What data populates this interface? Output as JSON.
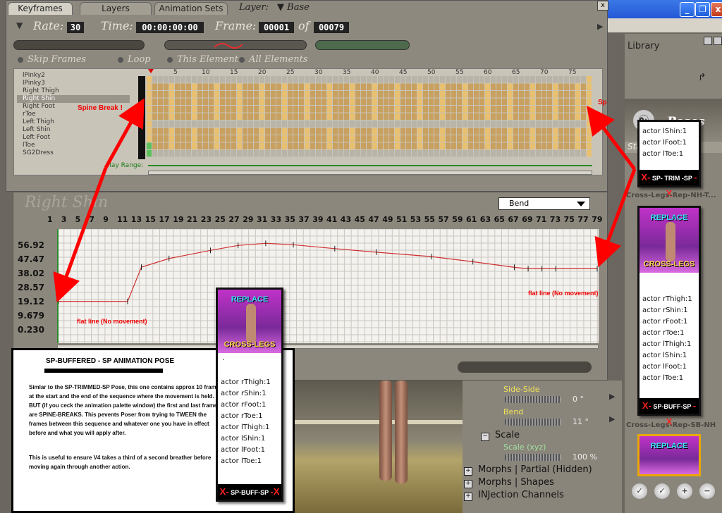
{
  "window": {
    "close": "x",
    "restore": "❐",
    "minimize": "_"
  },
  "tabs": [
    "Keyframes",
    "Layers",
    "Animation Sets"
  ],
  "layer": {
    "label": "Layer:",
    "value": "Base"
  },
  "transport": {
    "rate_label": "Rate:",
    "rate": "30",
    "time_label": "Time:",
    "time": "00:00:00:00",
    "frame_label": "Frame:",
    "frame": "00001",
    "of_label": "of",
    "total": "00079"
  },
  "options": {
    "skip": "Skip Frames",
    "loop": "Loop",
    "this": "This Element",
    "all": "All Elements"
  },
  "actors": [
    "lPinky2",
    "lPinky3",
    "Right Thigh",
    "Right Shin",
    "Right Foot",
    "rToe",
    "Left Thigh",
    "Left Shin",
    "Left Foot",
    "lToe",
    "SG2Dress"
  ],
  "selected_actor": "Right Shin",
  "ruler": [
    "5",
    "10",
    "15",
    "20",
    "25",
    "30",
    "35",
    "40",
    "45",
    "50",
    "55",
    "60",
    "65",
    "70",
    "75"
  ],
  "annotations": {
    "spine_left": "Spine Break !",
    "spine_right": "Spine Break !",
    "play_range": "Play Range:",
    "flat_left": "flat line (No movement)",
    "flat_right": "flat line (No movement)"
  },
  "graph": {
    "title": "Right Shin",
    "param": "Bend",
    "y_ticks": [
      "56.92",
      "47.47",
      "38.02",
      "28.57",
      "19.12",
      "9.679",
      "0.230"
    ],
    "x_ticks": [
      "1",
      "3",
      "5",
      "7",
      "9",
      "11",
      "13",
      "15",
      "17",
      "19",
      "21",
      "23",
      "25",
      "27",
      "29",
      "31",
      "33",
      "35",
      "37",
      "39",
      "41",
      "43",
      "45",
      "47",
      "49",
      "51",
      "53",
      "55",
      "57",
      "59",
      "61",
      "63",
      "65",
      "67",
      "69",
      "71",
      "73",
      "75",
      "77",
      "79"
    ]
  },
  "desc": {
    "title": "SP-BUFFERED - SP ANIMATION POSE",
    "p1": "Simlar to the SP-TRIMMED-SP Pose, this one contains approx 10 frames at the start and the end of the sequence where the movement is held. BUT (if you ceck the animation palette window) the first and last frames are SPINE-BREAKS. This pevents Poser from trying to TWEEN the frames between this sequence and whatever one you have in effect before and what you will apply after.",
    "p2": "This is useful to ensure V4 takes a third of a second breather before moving again through another action."
  },
  "card_center": {
    "replace": "REPLACE",
    "cross": "CROSS-LEGS",
    "dot": ".",
    "lines": [
      "actor rThigh:1",
      "actor rShin:1",
      "actor rFoot:1",
      "actor rToe:1",
      "actor lThigh:1",
      "actor lShin:1",
      "actor lFoot:1",
      "actor lToe:1"
    ],
    "tag": "SP-BUFF-SP"
  },
  "params": {
    "side": "Side-Side",
    "side_val": "0 °",
    "bend": "Bend",
    "bend_val": "11 °",
    "scale_hdr": "Scale",
    "scale": "Scale (xyz)",
    "scale_val": "100 %",
    "groups": [
      "Morphs | Partial (Hidden)",
      "Morphs | Shapes",
      "INJection Channels"
    ]
  },
  "library": {
    "title": "Library",
    "poses": "Poses",
    "category": "Standing",
    "card1": {
      "lines": [
        "actor lShin:1",
        "actor lFoot:1",
        "actor lToe:1"
      ],
      "tag": "SP- TRIM -SP",
      "cap": "Cross-Legs-Rep-NH-T..."
    },
    "card2": {
      "replace": "REPLACE",
      "cross": "CROSS-LEGS",
      "lines": [
        "actor rThigh:1",
        "actor rShin:1",
        "actor rFoot:1",
        "actor rToe:1",
        "actor lThigh:1",
        "actor lShin:1",
        "actor lFoot:1",
        "actor lToe:1"
      ],
      "tag": "SP-BUFF-SP",
      "cap": "Cross-Legs-Rep-SB-NH"
    },
    "card3": {
      "replace": "REPLACE"
    }
  },
  "chart_data": {
    "type": "line",
    "x": [
      1,
      11,
      13,
      17,
      23,
      27,
      31,
      35,
      41,
      47,
      55,
      61,
      67,
      69,
      71,
      73,
      79
    ],
    "y": [
      19.1,
      19.1,
      38.5,
      43.4,
      48,
      50.8,
      52,
      51.2,
      49,
      47,
      44.5,
      41.6,
      38.4,
      37.6,
      37.6,
      37.6,
      37.6
    ],
    "ylim": [
      0.23,
      56.92
    ],
    "xlim": [
      1,
      79
    ],
    "ylabel": "Bend"
  }
}
